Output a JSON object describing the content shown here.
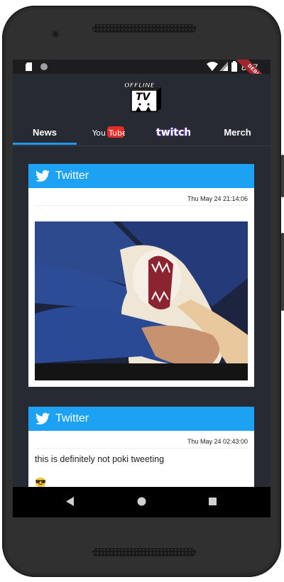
{
  "status_bar": {
    "time": "8:07",
    "icons": [
      "sd-card-icon",
      "sync-icon",
      "wifi-icon",
      "signal-icon",
      "battery-icon"
    ],
    "debug_banner": "DEBUG"
  },
  "app": {
    "logo_text_line1": "OFFLINE",
    "logo_text_line2": "TV",
    "tabs": [
      {
        "label": "News",
        "selected": true
      },
      {
        "label": "YouTube",
        "selected": false
      },
      {
        "label": "twitch",
        "selected": false
      },
      {
        "label": "Merch",
        "selected": false
      }
    ],
    "accent_color": "#2196f3",
    "background_color": "#262b33"
  },
  "feed": [
    {
      "source": "Twitter",
      "timestamp": "Thu May 24 21:14:06",
      "text": "",
      "has_image": true,
      "image_description": "white fluffy dog yawning in arms of person in blue sweater"
    },
    {
      "source": "Twitter",
      "timestamp": "Thu May 24 02:43:00",
      "text": "this is definitely not poki tweeting",
      "emoji": "😎"
    }
  ],
  "colors": {
    "twitter_blue": "#1da1f2",
    "youtube_red": "#e52d27",
    "twitch_purple": "#6441a5"
  }
}
